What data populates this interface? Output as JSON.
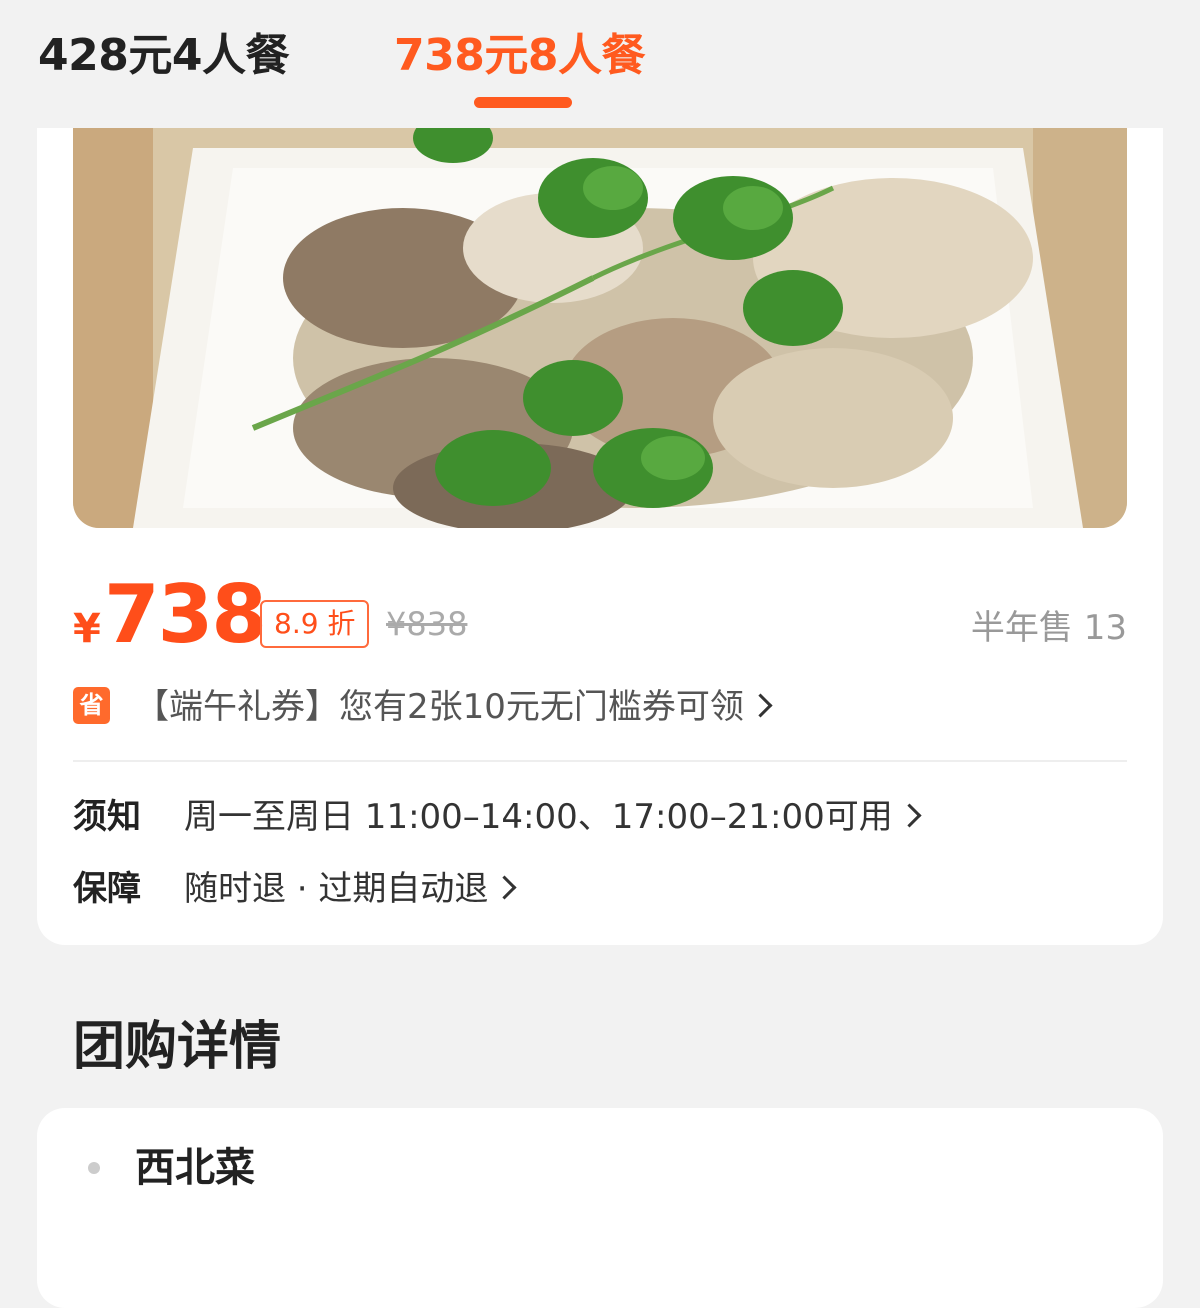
{
  "tabs": [
    {
      "label": "428元4人餐",
      "active": false
    },
    {
      "label": "738元8人餐",
      "active": true
    }
  ],
  "colors": {
    "accent": "#ff5a1f",
    "price": "#ff4e1a"
  },
  "product": {
    "currency": "¥",
    "price": "738",
    "discount": "8.9 折",
    "original_price": "¥838",
    "sold": "半年售 13"
  },
  "coupon": {
    "badge": "省",
    "text": "【端午礼券】您有2张10元无门槛券可领"
  },
  "info": {
    "notice_label": "须知",
    "notice_value": "周一至周日 11:00–14:00、17:00–21:00可用",
    "guarantee_label": "保障",
    "guarantee_value": "随时退 · 过期自动退"
  },
  "details": {
    "title": "团购详情",
    "items": [
      "西北菜"
    ]
  }
}
